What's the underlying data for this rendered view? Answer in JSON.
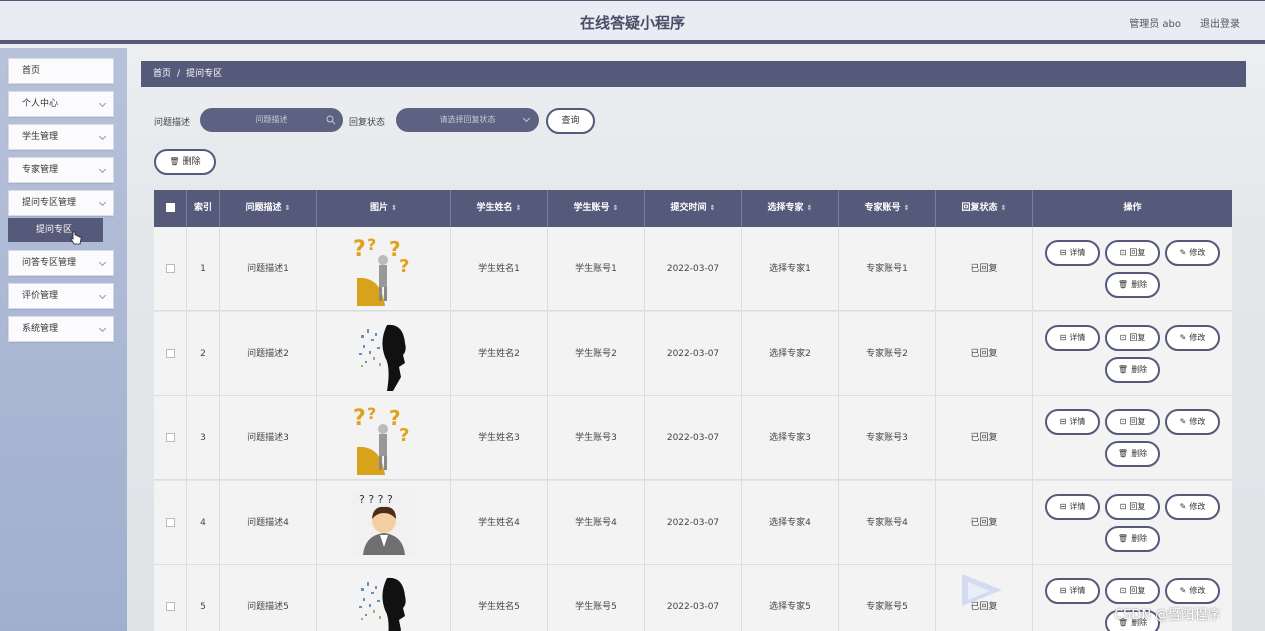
{
  "header": {
    "title": "在线答疑小程序",
    "user": "管理员 abo",
    "logout": "退出登录"
  },
  "sidebar": {
    "items": [
      {
        "label": "首页",
        "has_chevron": false
      },
      {
        "label": "个人中心",
        "has_chevron": true
      },
      {
        "label": "学生管理",
        "has_chevron": true
      },
      {
        "label": "专家管理",
        "has_chevron": true
      },
      {
        "label": "提问专区管理",
        "has_chevron": true
      },
      {
        "label": "问答专区管理",
        "has_chevron": true
      },
      {
        "label": "评价管理",
        "has_chevron": true
      },
      {
        "label": "系统管理",
        "has_chevron": true
      }
    ],
    "active_sub": "提问专区"
  },
  "breadcrumb": {
    "home": "首页",
    "sep": "/",
    "current": "提问专区"
  },
  "search": {
    "desc_label": "问题描述",
    "desc_placeholder": "问题描述",
    "status_label": "回复状态",
    "status_placeholder": "请选择回复状态",
    "query_button": "查询",
    "delete_button": "删除"
  },
  "table": {
    "headers": {
      "index": "索引",
      "desc": "问题描述",
      "image": "图片",
      "student_name": "学生姓名",
      "student_account": "学生账号",
      "submit_time": "提交时间",
      "expert": "选择专家",
      "expert_account": "专家账号",
      "status": "回复状态",
      "actions": "操作"
    },
    "rows": [
      {
        "index": "1",
        "desc": "问题描述1",
        "image": "question-marks-figure",
        "student_name": "学生姓名1",
        "student_account": "学生账号1",
        "submit_time": "2022-03-07",
        "expert": "选择专家1",
        "expert_account": "专家账号1",
        "status": "已回复"
      },
      {
        "index": "2",
        "desc": "问题描述2",
        "image": "silhouette-head",
        "student_name": "学生姓名2",
        "student_account": "学生账号2",
        "submit_time": "2022-03-07",
        "expert": "选择专家2",
        "expert_account": "专家账号2",
        "status": "已回复"
      },
      {
        "index": "3",
        "desc": "问题描述3",
        "image": "question-marks-figure",
        "student_name": "学生姓名3",
        "student_account": "学生账号3",
        "submit_time": "2022-03-07",
        "expert": "选择专家3",
        "expert_account": "专家账号3",
        "status": "已回复"
      },
      {
        "index": "4",
        "desc": "问题描述4",
        "image": "cartoon-thinking-man",
        "student_name": "学生姓名4",
        "student_account": "学生账号4",
        "submit_time": "2022-03-07",
        "expert": "选择专家4",
        "expert_account": "专家账号4",
        "status": "已回复"
      },
      {
        "index": "5",
        "desc": "问题描述5",
        "image": "silhouette-head",
        "student_name": "学生姓名5",
        "student_account": "学生账号5",
        "submit_time": "2022-03-07",
        "expert": "选择专家5",
        "expert_account": "专家账号5",
        "status": "已回复"
      }
    ],
    "actions": {
      "detail": "详情",
      "reply": "回复",
      "edit": "修改",
      "delete": "删除"
    }
  },
  "watermark": "CSDN @暨阳程序",
  "colors": {
    "primary": "#55597a",
    "header_bg": "#e9ecf3",
    "sidebar_bg": "#b7c2da",
    "row_bg": "#f3f3f4"
  }
}
